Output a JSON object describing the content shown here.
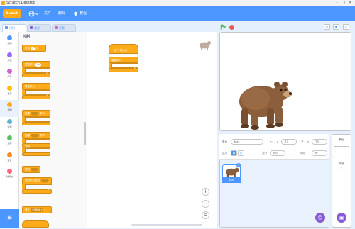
{
  "window": {
    "title": "Scratch Desktop",
    "buttons": [
      "–",
      "□",
      "✕"
    ]
  },
  "menubar": {
    "logo": "Scratch",
    "globe_icon": "globe-icon",
    "items": [
      "文件",
      "编辑"
    ],
    "tutorials": "教程"
  },
  "tabs": [
    {
      "label": "代码",
      "icon": "code-icon"
    },
    {
      "label": "造型",
      "icon": "costume-icon"
    },
    {
      "label": "声音",
      "icon": "sound-icon"
    }
  ],
  "categories": [
    {
      "label": "运动",
      "color": "#4c97ff"
    },
    {
      "label": "外观",
      "color": "#9966ff"
    },
    {
      "label": "声音",
      "color": "#cf63cf"
    },
    {
      "label": "事件",
      "color": "#ffbf00"
    },
    {
      "label": "控制",
      "color": "#ffab19"
    },
    {
      "label": "侦测",
      "color": "#5cb1d6"
    },
    {
      "label": "运算",
      "color": "#59c059"
    },
    {
      "label": "变量",
      "color": "#ff8c1a"
    },
    {
      "label": "自制积木",
      "color": "#ff6680"
    }
  ],
  "palette": {
    "title": "控制",
    "wait": "等待",
    "wait_value": "1",
    "wait_unit": "秒",
    "repeat": "重复执行",
    "repeat_value": "10",
    "forever": "重复执行",
    "if": "如果",
    "then": "那么",
    "else": "否则",
    "wait_until": "等待",
    "repeat_until": "重复执行直到",
    "stop": "停止",
    "stop_option": "全部脚本 ▾"
  },
  "script": {
    "hat_label": "当 ⚑ 被点击",
    "forever_label": "重复执行"
  },
  "zoom": {
    "in": "+",
    "out": "−",
    "reset": "="
  },
  "stage_controls": {
    "flag": "green-flag-icon",
    "stop": "stop-icon"
  },
  "sprite_info": {
    "sprite_label": "角色",
    "sprite_name": "Bear",
    "x_label": "x",
    "x_value": "-77",
    "y_label": "y",
    "y_value": "-73",
    "show_label": "显示",
    "size_label": "大小",
    "size_value": "100",
    "direction_label": "方向",
    "direction_value": "90"
  },
  "sprite_list": [
    {
      "name": "Bear"
    }
  ],
  "target_pane": {
    "title": "舞台",
    "backdrop_label": "背景",
    "backdrop_count": "1"
  },
  "accent": "#4c97ff",
  "control_color": "#ffab19"
}
